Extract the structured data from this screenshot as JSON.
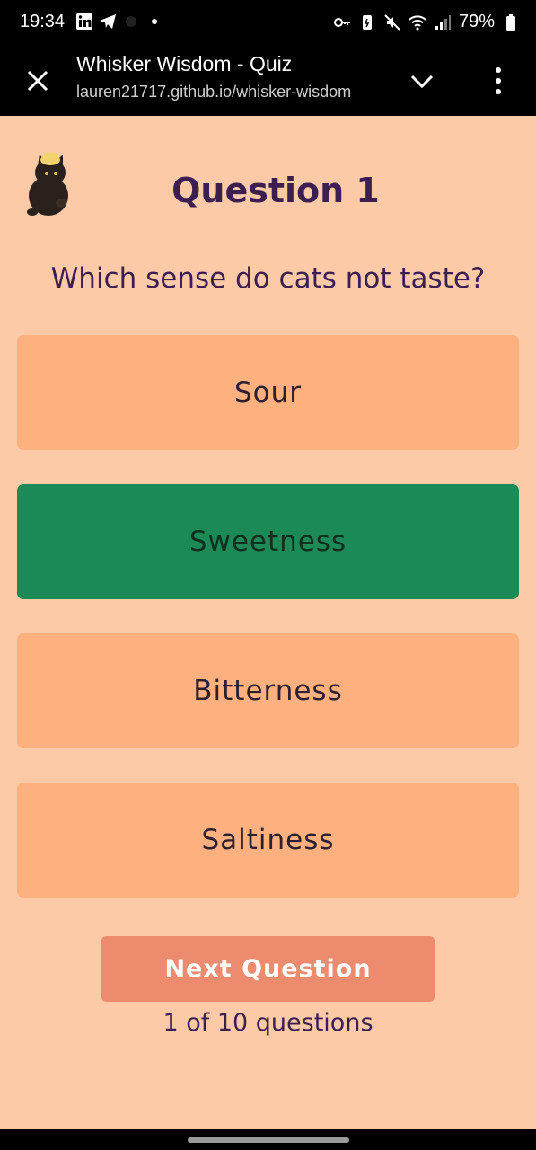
{
  "status_bar": {
    "time": "19:34",
    "battery": "79%"
  },
  "browser": {
    "title": "Whisker Wisdom - Quiz",
    "url": "lauren21717.github.io/whisker-wisdom"
  },
  "quiz": {
    "heading": "Question 1",
    "question": "Which sense do cats not taste?",
    "answers": [
      {
        "label": "Sour",
        "state": "default"
      },
      {
        "label": "Sweetness",
        "state": "correct"
      },
      {
        "label": "Bitterness",
        "state": "default"
      },
      {
        "label": "Saltiness",
        "state": "default"
      }
    ],
    "next_label": "Next Question",
    "progress": "1 of 10 questions"
  },
  "colors": {
    "background": "#fdcaa8",
    "answer": "#feb07f",
    "correct": "#1c8a56",
    "next_button": "#ec8b6e",
    "heading": "#3d1e50"
  }
}
